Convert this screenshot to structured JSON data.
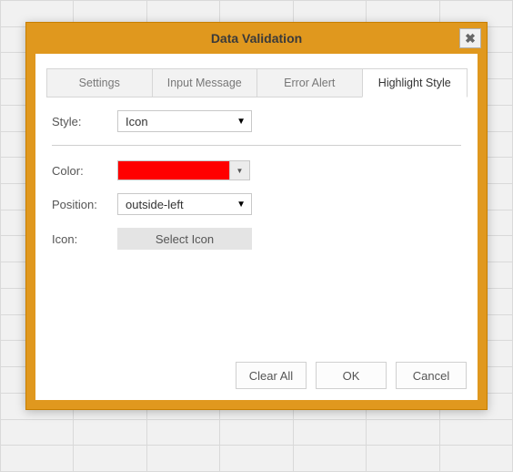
{
  "dialog": {
    "title": "Data Validation",
    "close_glyph": "✖",
    "tabs": {
      "settings": "Settings",
      "input_message": "Input Message",
      "error_alert": "Error Alert",
      "highlight_style": "Highlight Style"
    },
    "highlight": {
      "style_label": "Style:",
      "style_value": "Icon",
      "color_label": "Color:",
      "color_value": "#ff0000",
      "position_label": "Position:",
      "position_value": "outside-left",
      "icon_label": "Icon:",
      "select_icon_btn": "Select Icon"
    },
    "buttons": {
      "clear_all": "Clear All",
      "ok": "OK",
      "cancel": "Cancel"
    },
    "caret": "▼"
  }
}
